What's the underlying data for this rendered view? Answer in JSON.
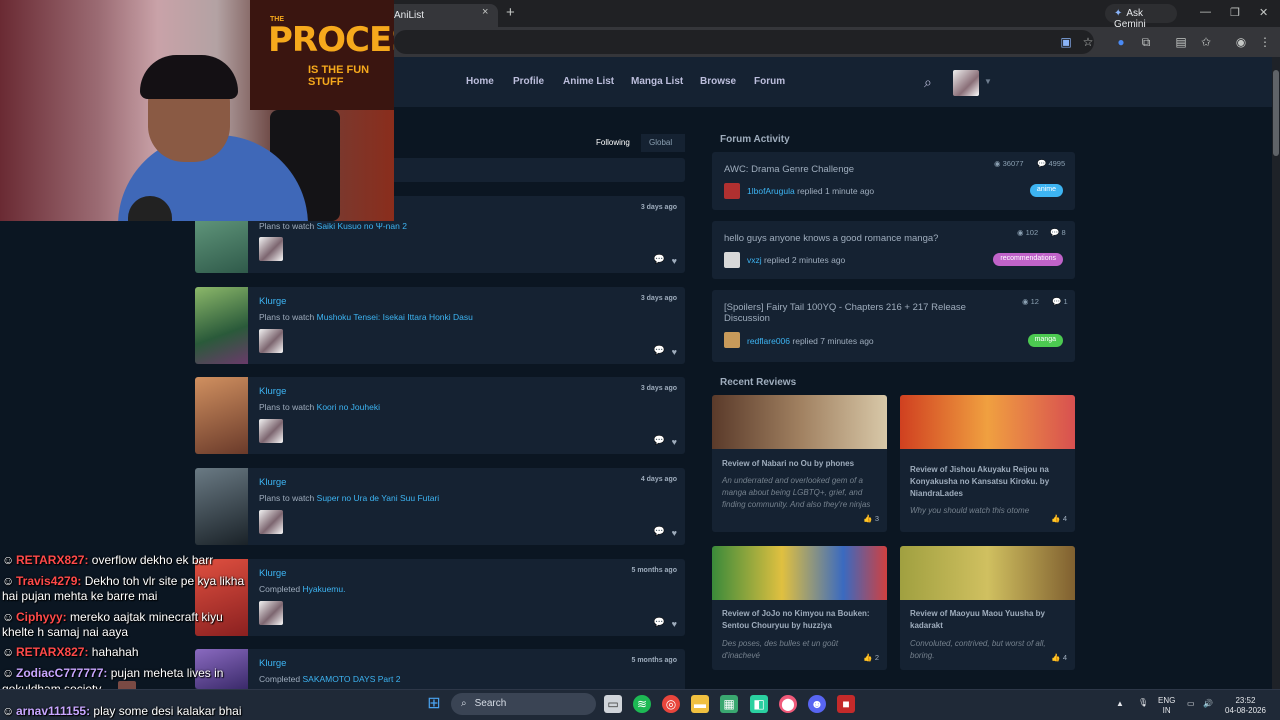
{
  "browser": {
    "tab_title": "AniList",
    "tab_close": "×",
    "new_tab": "+",
    "ask_gemini": "Ask Gemini"
  },
  "nav": {
    "items": [
      "Home",
      "Profile",
      "Anime List",
      "Manga List",
      "Browse",
      "Forum"
    ]
  },
  "feed": {
    "tab_following": "Following",
    "tab_global": "Global",
    "activities": [
      {
        "user": "",
        "action": "Plans to watch",
        "media": "Saiki Kusuo no Ψ-nan 2",
        "time": "3 days ago",
        "cover": "#5a8a6a"
      },
      {
        "user": "Klurge",
        "action": "Plans to watch",
        "media": "Mushoku Tensei: Isekai Ittara Honki Dasu",
        "time": "3 days ago",
        "cover": "#4c7a3c"
      },
      {
        "user": "Klurge",
        "action": "Plans to watch",
        "media": "Koori no Jouheki",
        "time": "3 days ago",
        "cover": "#8a5a3a"
      },
      {
        "user": "Klurge",
        "action": "Plans to watch",
        "media": "Super no Ura de Yani Suu Futari",
        "time": "4 days ago",
        "cover": "#3a4650"
      },
      {
        "user": "Klurge",
        "action": "Completed",
        "media": "Hyakuemu.",
        "time": "5 months ago",
        "cover": "#c0392b"
      },
      {
        "user": "Klurge",
        "action": "Completed",
        "media": "SAKAMOTO DAYS Part 2",
        "time": "5 months ago",
        "cover": "#6a4a9a"
      }
    ]
  },
  "forum": {
    "title": "Forum Activity",
    "threads": [
      {
        "title": "AWC: Drama Genre Challenge",
        "views": "36077",
        "replies": "4995",
        "user": "1lbofArugula",
        "replied": "replied 1 minute ago",
        "tag": "anime",
        "tag_color": "#3db4f2",
        "avatar_color": "#b03030"
      },
      {
        "title": "hello guys anyone knows a good romance manga?",
        "views": "102",
        "replies": "8",
        "user": "vxzj",
        "replied": "replied 2 minutes ago",
        "tag": "recommendations",
        "tag_color": "#c063c9",
        "avatar_color": "#d8d8d8"
      },
      {
        "title": "[Spoilers] Fairy Tail 100YQ - Chapters 216 + 217 Release Discussion",
        "views": "12",
        "replies": "1",
        "user": "redflare006",
        "replied": "replied 7 minutes ago",
        "tag": "manga",
        "tag_color": "#4cca51",
        "avatar_color": "#c89a5a"
      }
    ]
  },
  "reviews": {
    "title": "Recent Reviews",
    "items": [
      {
        "title": "Review of Nabari no Ou by phones",
        "summary": "An underrated and overlooked gem of a manga about being LGBTQ+, grief, and finding community. And also they're ninjas",
        "likes": "3",
        "banner": "linear-gradient(90deg,#5a3a2a,#a08060 50%,#d8c8a8)"
      },
      {
        "title": "Review of Jishou Akuyaku Reijou na Konyakusha no Kansatsu Kiroku. by NiandraLades",
        "summary": "Why you should watch this otome",
        "likes": "4",
        "banner": "linear-gradient(90deg,#d04020,#f0a040 50%,#d85050)"
      },
      {
        "title": "Review of JoJo no Kimyou na Bouken: Sentou Chouryuu by huzziya",
        "summary": "Des poses, des bulles et un goût d'inachevé",
        "likes": "2",
        "banner": "linear-gradient(90deg,#3a8a3a,#e0c040 40%,#3a6ac0 75%,#d04040)"
      },
      {
        "title": "Review of Maoyuu Maou Yuusha by kadarakt",
        "summary": "Convoluted, contrived, but worst of all, boring.",
        "likes": "4",
        "banner": "linear-gradient(90deg,#a0a040,#d0c060 50%,#806030)"
      }
    ]
  },
  "webcam": {
    "poster_line1": "THE",
    "poster_line2": "PROCESS",
    "poster_line3": "IS THE FUN STUFF"
  },
  "chat": [
    {
      "user": "RETARX827:",
      "msg": " overflow dekho ek barr",
      "color": "#ff4a4a"
    },
    {
      "user": "Travis4279:",
      "msg": " Dekho toh vlr site pe kya likha",
      "cont": "hai pujan mehta ke barre mai",
      "color": "#ff4a4a"
    },
    {
      "user": "Ciphyyy:",
      "msg": " mereko aajtak minecraft kiyu",
      "cont": "khelte h samaj nai aaya",
      "color": "#ff4a4a"
    },
    {
      "user": "RETARX827:",
      "msg": " hahahah",
      "color": "#ff4a4a"
    },
    {
      "user": "ZodiacC777777:",
      "msg": " pujan meheta lives in",
      "cont": "gokuldham society",
      "color": "#c8a6ff"
    },
    {
      "user": "arnav111155:",
      "msg": " play some desi kalakar bhai",
      "color": "#c8a6ff"
    }
  ],
  "taskbar": {
    "search": "Search",
    "lang1": "ENG",
    "lang2": "IN",
    "time": "23:52",
    "date": "04-08-2026"
  }
}
